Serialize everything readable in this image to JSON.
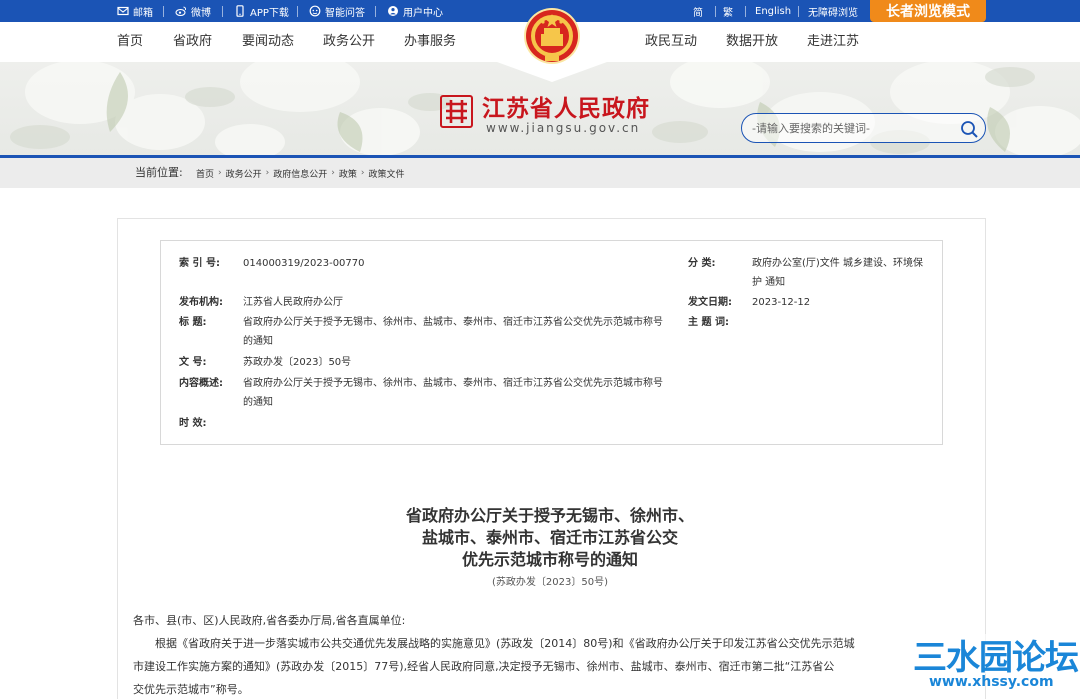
{
  "topbar": {
    "links": [
      {
        "label": "邮箱",
        "icon": "mail-icon"
      },
      {
        "label": "微博",
        "icon": "weibo-icon"
      },
      {
        "label": "APP下载",
        "icon": "phone-icon"
      },
      {
        "label": "智能问答",
        "icon": "robot-icon"
      },
      {
        "label": "用户中心",
        "icon": "user-icon"
      }
    ],
    "right_links": [
      "简",
      "繁",
      "English",
      "无障碍浏览"
    ],
    "elder_mode": "长者浏览模式"
  },
  "nav": {
    "left": [
      "首页",
      "省政府",
      "要闻动态",
      "政务公开",
      "办事服务"
    ],
    "right": [
      "政民互动",
      "数据开放",
      "走进江苏"
    ]
  },
  "brand": {
    "title": "江苏省人民政府",
    "url": "www.jiangsu.gov.cn",
    "primary_color": "#1b54b5",
    "red": "#c8161d"
  },
  "search": {
    "placeholder": "-请输入要搜索的关键词-"
  },
  "breadcrumb": {
    "label": "当前位置:",
    "items": [
      "首页",
      "政务公开",
      "政府信息公开",
      "政策",
      "政策文件"
    ]
  },
  "meta": {
    "index_key": "索 引 号:",
    "index_val": "014000319/2023-00770",
    "category_key": "分 类:",
    "category_val": "政府办公室(厅)文件 城乡建设、环境保护 通知",
    "org_key": "发布机构:",
    "org_val": "江苏省人民政府办公厅",
    "date_key": "发文日期:",
    "date_val": "2023-12-12",
    "title_key": "标 题:",
    "title_val": "省政府办公厅关于授予无锡市、徐州市、盐城市、泰州市、宿迁市江苏省公交优先示范城市称号的通知",
    "subject_key": "主 题 词:",
    "subject_val": "",
    "docno_key": "文 号:",
    "docno_val": "苏政办发〔2023〕50号",
    "summary_key": "内容概述:",
    "summary_val": "省政府办公厅关于授予无锡市、徐州市、盐城市、泰州市、宿迁市江苏省公交优先示范城市称号的通知",
    "effect_key": "时 效:",
    "effect_val": ""
  },
  "doc": {
    "title_lines": [
      "省政府办公厅关于授予无锡市、徐州市、",
      "盐城市、泰州市、宿迁市江苏省公交",
      "优先示范城市称号的通知"
    ],
    "subtitle": "(苏政办发〔2023〕50号)",
    "addressee": "各市、县(市、区)人民政府,省各委办厅局,省各直属单位:",
    "body_lines": [
      "根据《省政府关于进一步落实城市公共交通优先发展战略的实施意见》(苏政发〔2014〕80号)和《省政府办公厅关于印发江苏省公交优先示范城",
      "市建设工作实施方案的通知》(苏政办发〔2015〕77号),经省人民政府同意,决定授予无锡市、徐州市、盐城市、泰州市、宿迁市第二批“江苏省公",
      "交优先示范城市”称号。"
    ]
  },
  "watermark": {
    "text": "三水园论坛",
    "url": "www.xhssy.com"
  }
}
